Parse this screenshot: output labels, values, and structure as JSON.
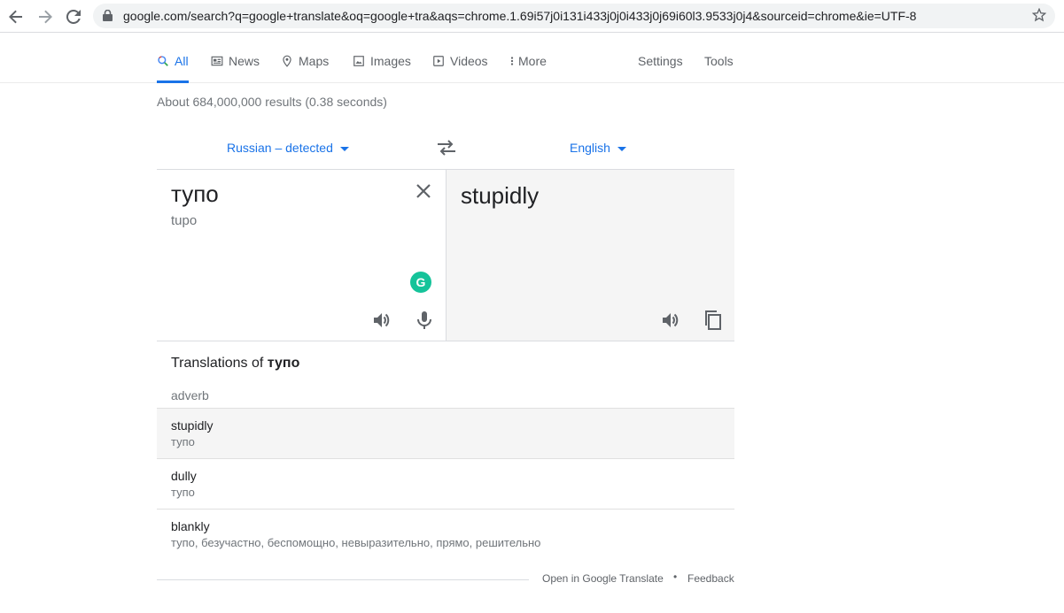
{
  "browser": {
    "url": "google.com/search?q=google+translate&oq=google+tra&aqs=chrome.1.69i57j0i131i433j0j0i433j0j69i60l3.9533j0j4&sourceid=chrome&ie=UTF-8"
  },
  "tabs": {
    "all": "All",
    "news": "News",
    "maps": "Maps",
    "images": "Images",
    "videos": "Videos",
    "more": "More",
    "settings": "Settings",
    "tools": "Tools"
  },
  "result_stats": "About 684,000,000 results (0.38 seconds)",
  "translator": {
    "source_lang": "Russian – detected",
    "target_lang": "English",
    "source_text": "тупо",
    "transliteration": "tupo",
    "target_text": "stupidly",
    "grammarly_letter": "G"
  },
  "translations": {
    "title_prefix": "Translations of ",
    "title_word": "тупо",
    "part_of_speech": "adverb",
    "rows": [
      {
        "word": "stupidly",
        "synonyms": "тупо"
      },
      {
        "word": "dully",
        "synonyms": "тупо"
      },
      {
        "word": "blankly",
        "synonyms": "тупо, безучастно, беспомощно, невыразительно, прямо, решительно"
      }
    ]
  },
  "footer": {
    "open_link": "Open in Google Translate",
    "separator": "•",
    "feedback": "Feedback"
  }
}
